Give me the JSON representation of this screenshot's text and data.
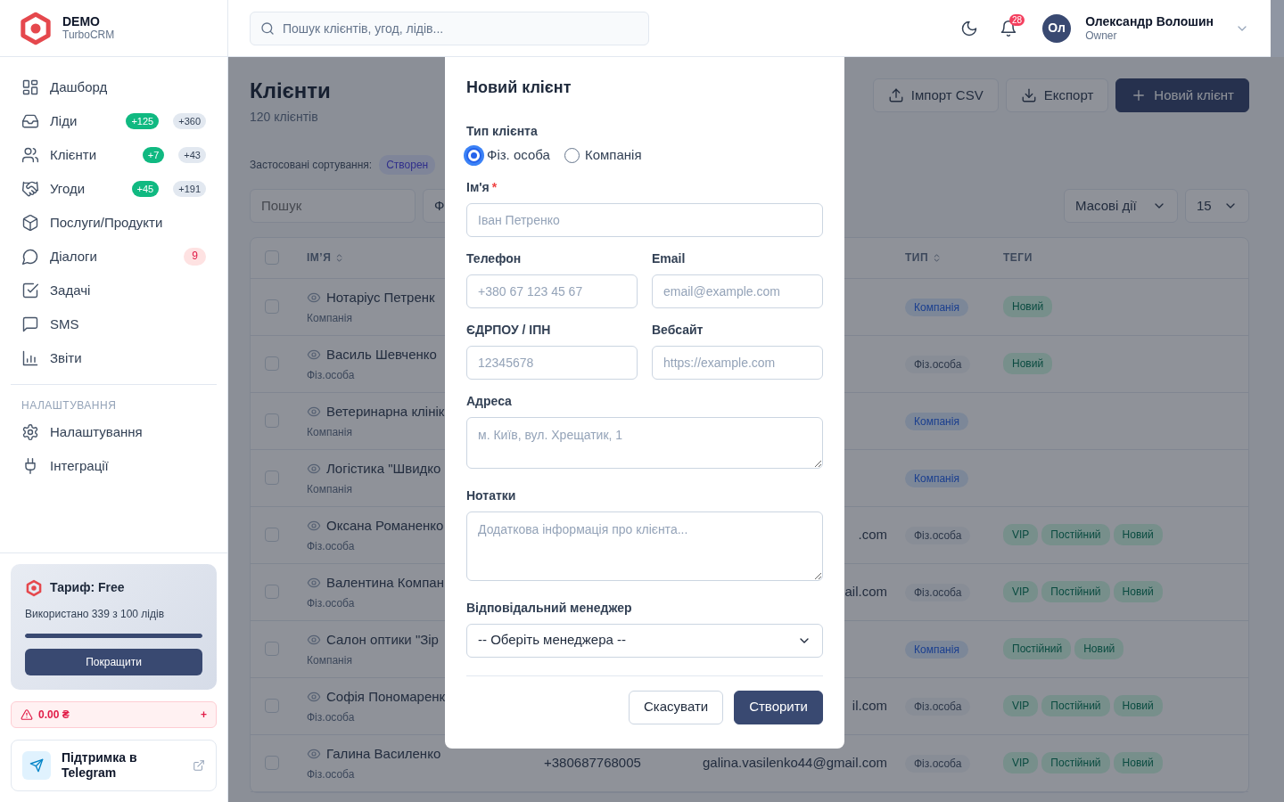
{
  "sidebar": {
    "brand": {
      "name": "DEMO",
      "product": "TurboCRM"
    },
    "nav": [
      {
        "label": "Дашборд",
        "selected": false
      },
      {
        "label": "Ліди",
        "selected": false,
        "badges": [
          {
            "text": "+125",
            "kind": "new"
          },
          {
            "text": "+360",
            "kind": "total"
          }
        ]
      },
      {
        "label": "Клієнти",
        "selected": false,
        "badges": [
          {
            "text": "+7",
            "kind": "new"
          },
          {
            "text": "+43",
            "kind": "total"
          }
        ]
      },
      {
        "label": "Угоди",
        "selected": false,
        "badges": [
          {
            "text": "+45",
            "kind": "new"
          },
          {
            "text": "+191",
            "kind": "total"
          }
        ]
      },
      {
        "label": "Послуги/Продукти",
        "selected": false
      },
      {
        "label": "Діалоги",
        "selected": false,
        "badges": [
          {
            "text": "9",
            "kind": "alert"
          }
        ]
      },
      {
        "label": "Задачі",
        "selected": false
      },
      {
        "label": "SMS",
        "selected": false
      },
      {
        "label": "Звіти",
        "selected": false
      }
    ],
    "settings": {
      "title": "НАЛАШТУВАННЯ",
      "items": [
        {
          "label": "Налаштування",
          "selected": false
        },
        {
          "label": "Інтеграції",
          "selected": false
        }
      ]
    },
    "plan": {
      "title": "Тариф: Free",
      "usage": "Використано 339 з 100 лідів",
      "level": 1,
      "button": "Покращити"
    },
    "balance": {
      "amount": "0.00 ₴",
      "action": "+"
    },
    "support": {
      "label": "Підтримка в Telegram"
    }
  },
  "header": {
    "search": {
      "placeholder": "Пошук клієнтів, угод, лідів..."
    },
    "notifications": "28",
    "user": {
      "initials": "Ол",
      "name": "Олександр Волошин",
      "role": "Owner"
    }
  },
  "page": {
    "title": "Клієнти",
    "subtitle": "120 клієнтів",
    "actions": [
      {
        "label": "Імпорт CSV",
        "kind": "import"
      },
      {
        "label": "Експорт",
        "kind": "export"
      },
      {
        "label": "Новий клієнт",
        "kind": "create"
      }
    ],
    "sorting": {
      "label": "Застосовані сортування:",
      "chip": "Створен"
    },
    "toolbar": {
      "search_placeholder": "Пошук",
      "filter": "Ф",
      "bulk": "Масові дії",
      "per_page": "15"
    },
    "table": {
      "checked": false,
      "columns": [
        {
          "label": "ІМ’Я",
          "sortable": true
        },
        {
          "label": "ТИП",
          "sortable": true
        },
        {
          "label": "ТЕГИ",
          "sortable": false
        }
      ],
      "rows": [
        {
          "checked": false,
          "name": "Нотаріус Петренк",
          "subtitle": "Компанія",
          "type": {
            "label": "Компанія",
            "kind": "company"
          },
          "tags": [
            "Новий"
          ]
        },
        {
          "checked": false,
          "name": "Василь Шевченко",
          "subtitle": "Фіз.особа",
          "type": {
            "label": "Фіз.особа",
            "kind": "person"
          },
          "tags": [
            "Новий"
          ]
        },
        {
          "checked": false,
          "name": "Ветеринарна клінік",
          "subtitle": "Компанія",
          "type": {
            "label": "Компанія",
            "kind": "company"
          }
        },
        {
          "checked": false,
          "name": "Логістика \"Швидко",
          "subtitle": "Компанія",
          "type": {
            "label": "Компанія",
            "kind": "company"
          }
        },
        {
          "checked": false,
          "name": "Оксана Романенко",
          "subtitle": "Фіз.особа",
          "email": ".com",
          "type": {
            "label": "Фіз.особа",
            "kind": "person"
          },
          "tags": [
            "VIP",
            "Постійний",
            "Новий"
          ]
        },
        {
          "checked": false,
          "name": "Валентина Компан",
          "subtitle": "Фіз.особа",
          "email": "ail.com",
          "type": {
            "label": "Фіз.особа",
            "kind": "person"
          },
          "tags": [
            "VIP",
            "Постійний",
            "Новий"
          ]
        },
        {
          "checked": false,
          "name": "Салон оптики \"Зір",
          "subtitle": "Компанія",
          "type": {
            "label": "Компанія",
            "kind": "company"
          },
          "tags": [
            "Постійний",
            "Новий"
          ]
        },
        {
          "checked": false,
          "name": "Софія Пономаренк",
          "subtitle": "Фіз.особа",
          "email": "il.com",
          "type": {
            "label": "Фіз.особа",
            "kind": "person"
          },
          "tags": [
            "VIP",
            "Постійний",
            "Новий"
          ]
        },
        {
          "checked": false,
          "name": "Галина Василенко",
          "subtitle": "Фіз.особа",
          "phone": "+380687768005",
          "email": "galina.vasilenko44@gmail.com",
          "type": {
            "label": "Фіз.особа",
            "kind": "person"
          },
          "tags": [
            "VIP",
            "Постійний",
            "Новий"
          ]
        }
      ]
    }
  },
  "modal": {
    "title": "Новий клієнт",
    "rows": [
      [
        {
          "kind": "radio",
          "label": "Тип клієнта",
          "options": [
            {
              "label": "Фіз. особа",
              "selected": true
            },
            {
              "label": "Компанія",
              "selected": false
            }
          ]
        }
      ],
      [
        {
          "kind": "text",
          "label": "Ім'я",
          "required_mark": "*",
          "placeholder": "Іван Петренко"
        }
      ],
      [
        {
          "kind": "text",
          "label": "Телефон",
          "placeholder": "+380 67 123 45 67"
        },
        {
          "kind": "text",
          "label": "Email",
          "placeholder": "email@example.com"
        }
      ],
      [
        {
          "kind": "text",
          "label": "ЄДРПОУ / ІПН",
          "placeholder": "12345678"
        },
        {
          "kind": "text",
          "label": "Вебсайт",
          "placeholder": "https://example.com"
        }
      ],
      [
        {
          "kind": "textarea",
          "label": "Адреса",
          "placeholder": "м. Київ, вул. Хрещатик, 1"
        }
      ],
      [
        {
          "kind": "textarea",
          "label": "Нотатки",
          "placeholder": "Додаткова інформація про клієнта..."
        }
      ],
      [
        {
          "kind": "select",
          "label": "Відповідальний менеджер",
          "value": "-- Оберіть менеджера --"
        }
      ]
    ],
    "buttons": [
      {
        "label": "Скасувати",
        "kind": "secondary"
      },
      {
        "label": "Створити",
        "kind": "primary"
      }
    ]
  }
}
